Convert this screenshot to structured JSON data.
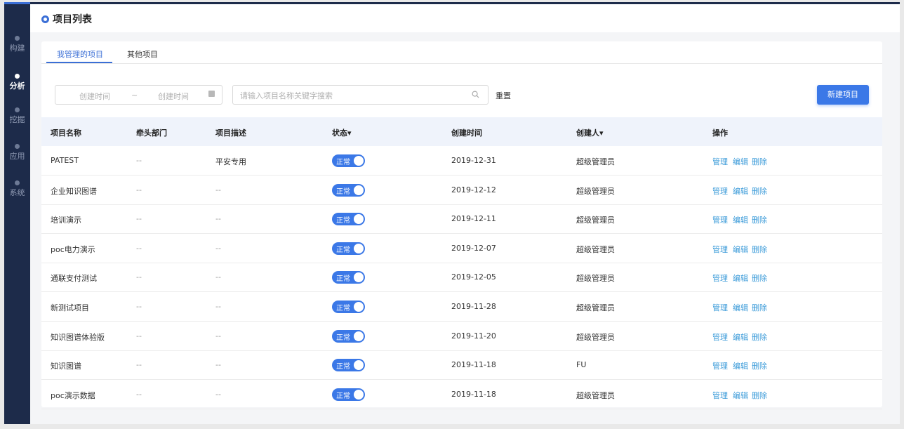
{
  "sidebar": {
    "items": [
      {
        "label": "构建",
        "icon": "layers-icon"
      },
      {
        "label": "分析",
        "icon": "pie-icon",
        "active": true
      },
      {
        "label": "挖掘",
        "icon": "nodes-icon"
      },
      {
        "label": "应用",
        "icon": "cube-icon"
      },
      {
        "label": "系统",
        "icon": "gear-icon"
      }
    ]
  },
  "header": {
    "title": "项目列表"
  },
  "tabs": [
    {
      "label": "我管理的项目",
      "active": true
    },
    {
      "label": "其他项目"
    }
  ],
  "filters": {
    "start_placeholder": "创建时间",
    "separator": "~",
    "end_placeholder": "创建时间",
    "search_placeholder": "请输入项目名称关键字搜索",
    "reset_label": "重置",
    "new_button_label": "新建项目"
  },
  "table": {
    "headers": [
      "项目名称",
      "牵头部门",
      "项目描述",
      "状态▾",
      "创建时间",
      "创建人▾",
      "操作"
    ],
    "rows": [
      {
        "name": "PATEST",
        "dept": "--",
        "desc": "平安专用",
        "status": "正常",
        "created": "2019-12-31",
        "creator": "超级管理员"
      },
      {
        "name": "企业知识图谱",
        "dept": "--",
        "desc": "--",
        "status": "正常",
        "created": "2019-12-12",
        "creator": "超级管理员"
      },
      {
        "name": "培训演示",
        "dept": "--",
        "desc": "--",
        "status": "正常",
        "created": "2019-12-11",
        "creator": "超级管理员"
      },
      {
        "name": "poc电力演示",
        "dept": "--",
        "desc": "--",
        "status": "正常",
        "created": "2019-12-07",
        "creator": "超级管理员"
      },
      {
        "name": "通联支付测试",
        "dept": "--",
        "desc": "--",
        "status": "正常",
        "created": "2019-12-05",
        "creator": "超级管理员"
      },
      {
        "name": "新测试项目",
        "dept": "--",
        "desc": "--",
        "status": "正常",
        "created": "2019-11-28",
        "creator": "超级管理员"
      },
      {
        "name": "知识图谱体验版",
        "dept": "--",
        "desc": "--",
        "status": "正常",
        "created": "2019-11-20",
        "creator": "超级管理员"
      },
      {
        "name": "知识图谱",
        "dept": "--",
        "desc": "--",
        "status": "正常",
        "created": "2019-11-18",
        "creator": "FU"
      },
      {
        "name": "poc演示数据",
        "dept": "--",
        "desc": "--",
        "status": "正常",
        "created": "2019-11-18",
        "creator": "超级管理员"
      }
    ],
    "actions": {
      "manage": "管理",
      "edit": "编辑",
      "delete": "删除"
    }
  },
  "colors": {
    "accent": "#3b78e7",
    "sidebar_bg": "#1d2b4a",
    "link": "#3b9bd9"
  }
}
